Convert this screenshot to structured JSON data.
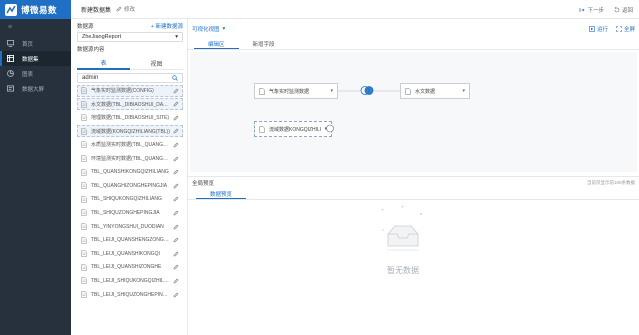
{
  "brand": {
    "name": "博微易数",
    "color": "#1f70c4"
  },
  "nav": {
    "collapse_glyph": "≡",
    "items": [
      {
        "label": "首页",
        "icon": "monitor-icon"
      },
      {
        "label": "数据集",
        "icon": "dataset-icon",
        "active": true
      },
      {
        "label": "图表",
        "icon": "chart-icon"
      },
      {
        "label": "数据大屏",
        "icon": "screen-icon"
      }
    ]
  },
  "topbar": {
    "title": "新建数据集",
    "edit_label": "修改",
    "prev_label": "下一步",
    "back_label": "返回"
  },
  "panel": {
    "datasource_label": "数据源",
    "add_datasource_label": "+ 新建数据源",
    "datasource_value": "ZheJiangReport",
    "content_label": "数据源内容",
    "tabs": [
      "表",
      "视图"
    ],
    "search_value": "admin",
    "tables": [
      {
        "name": "气象实时监测数据(CONFIG)",
        "selected": true
      },
      {
        "name": "水文数据(TBL_DIBIAOSHUI_DATA)",
        "selected": true
      },
      {
        "name": "地理数据(TBL_DIBIAOSHUI_SITE)",
        "selected": false
      },
      {
        "name": "流域数据(KONGQIZHILIANG(TBL))",
        "selected": true
      },
      {
        "name": "水质监测实时数据(TBL_QUANGUO)",
        "selected": false
      },
      {
        "name": "环境监测实时数据(TBL_QUANGUO)",
        "selected": false
      },
      {
        "name": "TBL_QUANSHIKONGQIZHILIANG",
        "selected": false
      },
      {
        "name": "TBL_QUANGHIZONGHEPINGJIA",
        "selected": false
      },
      {
        "name": "TBL_SHIQUKONGQIZHILIANG",
        "selected": false
      },
      {
        "name": "TBL_SHIQUZONGHEPINGJIA",
        "selected": false
      },
      {
        "name": "TBL_YINYONGSHUI_DUODIAN",
        "selected": false
      },
      {
        "name": "TBL_LEIJI_QUANSHENGZONGHE",
        "selected": false
      },
      {
        "name": "TBL_LEIJI_QUANSHIKONGQI",
        "selected": false
      },
      {
        "name": "TBL_LEIJI_QUANSHIZONGHE",
        "selected": false
      },
      {
        "name": "TBL_LEIJI_SHIQUKONGQIZHILIANG",
        "selected": false
      },
      {
        "name": "TBL_LEIJI_SHIQUZONGHEPINGJIA",
        "selected": false
      }
    ]
  },
  "work": {
    "breadcrumb": "可视化视图",
    "actions": [
      "运行",
      "全屏"
    ],
    "tabs": [
      "编辑区",
      "新增字段"
    ],
    "nodes": [
      {
        "label": "气象实时监测数据"
      },
      {
        "label": "水文数据"
      },
      {
        "label": "流域数据KONGQIZHILIANG"
      }
    ],
    "preview_label": "全局预览",
    "preview_hint": "当前仅显示前100条数据",
    "preview_tab": "数据预览",
    "empty_text": "暂无数据"
  }
}
